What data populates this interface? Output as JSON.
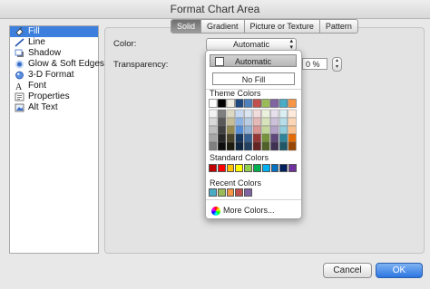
{
  "window": {
    "title": "Format Chart Area"
  },
  "sidebar": {
    "items": [
      {
        "label": "Fill",
        "icon": "paint-bucket-icon",
        "active": true
      },
      {
        "label": "Line",
        "icon": "line-icon"
      },
      {
        "label": "Shadow",
        "icon": "shadow-icon"
      },
      {
        "label": "Glow & Soft Edges",
        "icon": "glow-icon"
      },
      {
        "label": "3-D Format",
        "icon": "3d-format-icon"
      },
      {
        "label": "Font",
        "icon": "font-icon"
      },
      {
        "label": "Properties",
        "icon": "properties-icon"
      },
      {
        "label": "Alt Text",
        "icon": "alt-text-icon"
      }
    ]
  },
  "tabs": [
    "Solid",
    "Gradient",
    "Picture or Texture",
    "Pattern"
  ],
  "fields": {
    "color_label": "Color:",
    "color_value": "Automatic",
    "transparency_label": "Transparency:",
    "transparency_value": "0 %"
  },
  "color_menu": {
    "automatic": "Automatic",
    "no_fill": "No Fill",
    "theme_label": "Theme Colors",
    "theme_top": [
      "#ffffff",
      "#000000",
      "#eeece1",
      "#1f497d",
      "#4f81bd",
      "#c0504d",
      "#9bbb59",
      "#8064a2",
      "#4bacc6",
      "#f79646"
    ],
    "theme_columns": [
      [
        "#f2f2f2",
        "#d9d9d9",
        "#bfbfbf",
        "#a6a6a6",
        "#808080"
      ],
      [
        "#7f7f7f",
        "#595959",
        "#404040",
        "#262626",
        "#0d0d0d"
      ],
      [
        "#ddd9c3",
        "#c4bd97",
        "#938953",
        "#494429",
        "#1d1b10"
      ],
      [
        "#c6d9f0",
        "#8db3e2",
        "#548dd4",
        "#17365d",
        "#0f243e"
      ],
      [
        "#dbe5f1",
        "#b8cce4",
        "#95b3d7",
        "#366092",
        "#244061"
      ],
      [
        "#f2dcdb",
        "#e5b9b7",
        "#d99694",
        "#953734",
        "#632423"
      ],
      [
        "#ebf1dd",
        "#d7e3bc",
        "#c3d69b",
        "#76923c",
        "#4f6128"
      ],
      [
        "#e5e0ec",
        "#ccc1d9",
        "#b2a2c7",
        "#5f497a",
        "#3f3151"
      ],
      [
        "#dbeef3",
        "#b7dde8",
        "#92cddc",
        "#31859b",
        "#205867"
      ],
      [
        "#fdeada",
        "#fbd5b5",
        "#fac08f",
        "#e36c09",
        "#974806"
      ]
    ],
    "standard_label": "Standard Colors",
    "standard": [
      "#c00000",
      "#ff0000",
      "#ffc000",
      "#ffff00",
      "#92d050",
      "#00b050",
      "#00b0f0",
      "#0070c0",
      "#002060",
      "#7030a0"
    ],
    "recent_label": "Recent Colors",
    "recent": [
      "#4bacc6",
      "#9bbb59",
      "#f79646",
      "#c0504d",
      "#8064a2"
    ],
    "more_colors": "More Colors..."
  },
  "buttons": {
    "cancel": "Cancel",
    "ok": "OK"
  }
}
